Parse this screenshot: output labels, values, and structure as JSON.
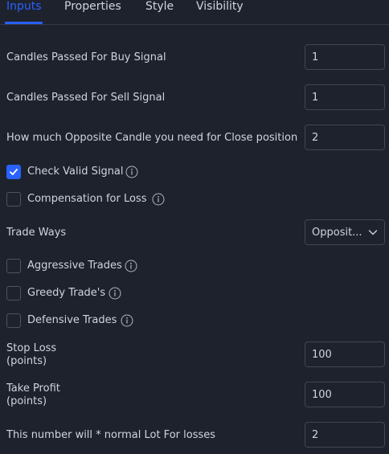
{
  "tabs": [
    {
      "label": "Inputs",
      "active": true
    },
    {
      "label": "Properties",
      "active": false
    },
    {
      "label": "Style",
      "active": false
    },
    {
      "label": "Visibility",
      "active": false
    }
  ],
  "inputs": {
    "candles_buy": {
      "label": "Candles Passed For Buy Signal",
      "value": "1"
    },
    "candles_sell": {
      "label": "Candles Passed For Sell Signal",
      "value": "1"
    },
    "opposite_candle": {
      "label": "How much Opposite Candle you need for Close position",
      "value": "2"
    },
    "check_valid_signal": {
      "label": "Check Valid Signal",
      "checked": true
    },
    "compensation_for_loss": {
      "label": "Compensation for Loss",
      "checked": false
    },
    "trade_ways": {
      "label": "Trade Ways",
      "value": "Opposit..."
    },
    "aggressive_trades": {
      "label": "Aggressive Trades",
      "checked": false
    },
    "greedy_trades": {
      "label": "Greedy Trade's",
      "checked": false
    },
    "defensive_trades": {
      "label": "Defensive Trades",
      "checked": false
    },
    "stop_loss": {
      "label_line1": "Stop Loss",
      "label_line2": "(points)",
      "value": "100"
    },
    "take_profit": {
      "label_line1": "Take Profit",
      "label_line2": "(points)",
      "value": "100"
    },
    "lot_multiplier": {
      "label": "This number will * normal Lot For losses",
      "value": "2"
    }
  },
  "icons": {
    "info": "info-circle-icon",
    "checkmark": "checkmark-icon",
    "chevron": "chevron-down-icon"
  },
  "colors": {
    "background": "#1e222d",
    "accent": "#2962ff",
    "text": "#d1d4dc",
    "border": "#434651",
    "muted": "#787b86"
  }
}
